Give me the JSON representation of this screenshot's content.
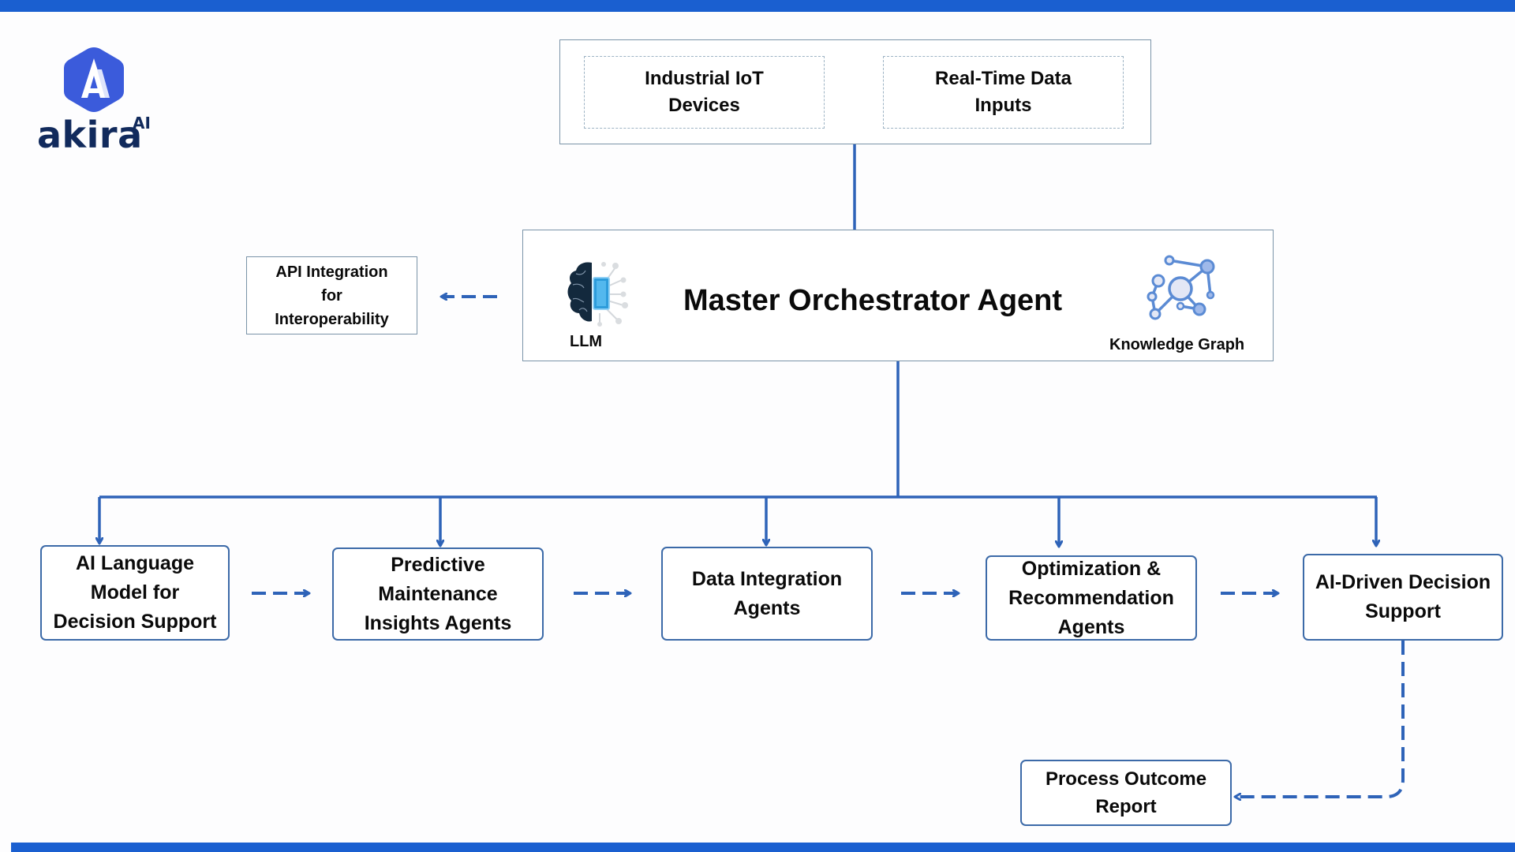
{
  "brand": {
    "name": "akira",
    "superscript": "AI",
    "logo_color": "#3b5bdb",
    "text_color": "#112a5c"
  },
  "colors": {
    "accent_bar": "#1a5fd0",
    "connector": "#2e63b8",
    "agent_border": "#3c6aa8"
  },
  "inputs": {
    "items": [
      {
        "label": "Industrial IoT Devices",
        "lines": [
          "Industrial IoT",
          "Devices"
        ]
      },
      {
        "label": "Real-Time Data Inputs",
        "lines": [
          "Real-Time Data",
          "Inputs"
        ]
      }
    ]
  },
  "api": {
    "lines": [
      "API Integration",
      "for",
      "Interoperability"
    ]
  },
  "master": {
    "title": "Master Orchestrator Agent",
    "llm_label": "LLM",
    "llm_icon": "brain-chip-icon",
    "kg_label": "Knowledge Graph",
    "kg_icon": "network-graph-icon"
  },
  "agents": [
    {
      "lines": [
        "AI Language",
        "Model for",
        "Decision Support"
      ]
    },
    {
      "lines": [
        "Predictive",
        "Maintenance",
        "Insights Agents"
      ]
    },
    {
      "lines": [
        "Data Integration",
        "Agents"
      ]
    },
    {
      "lines": [
        "Optimization &",
        "Recommendation",
        "Agents"
      ]
    },
    {
      "lines": [
        "AI-Driven Decision",
        "Support"
      ]
    }
  ],
  "output": {
    "lines": [
      "Process Outcome",
      "Report"
    ]
  }
}
